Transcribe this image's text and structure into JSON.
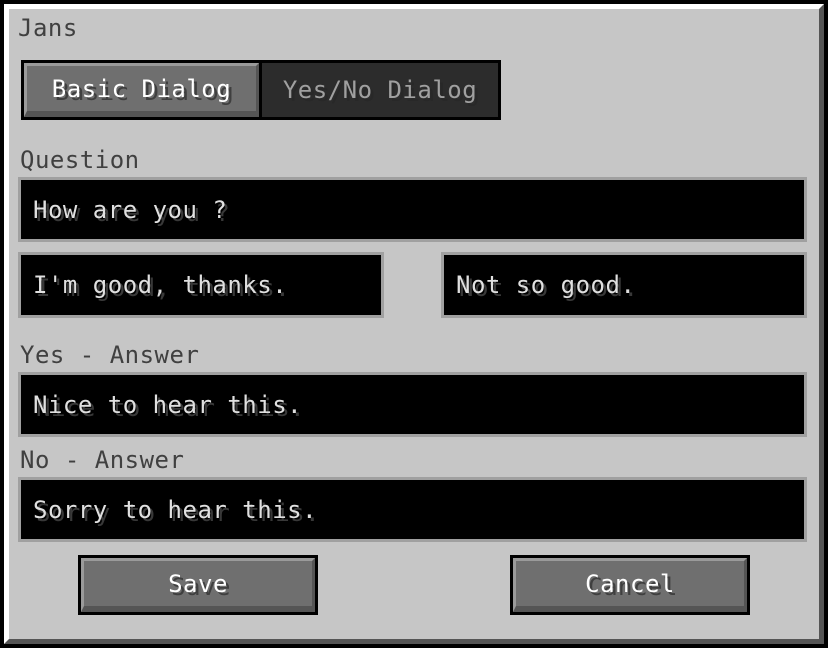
{
  "dialog": {
    "title": "Jans",
    "tabs": [
      {
        "label": "Basic Dialog",
        "active": true
      },
      {
        "label": "Yes/No Dialog",
        "active": false
      }
    ],
    "question": {
      "label": "Question",
      "value": "How are you ?"
    },
    "answers": {
      "yes_option": "I'm good, thanks.",
      "no_option": "Not so good."
    },
    "yes_answer": {
      "label": "Yes - Answer",
      "value": "Nice to hear this."
    },
    "no_answer": {
      "label": "No - Answer",
      "value": "Sorry to hear this."
    },
    "buttons": {
      "save": "Save",
      "cancel": "Cancel"
    }
  }
}
